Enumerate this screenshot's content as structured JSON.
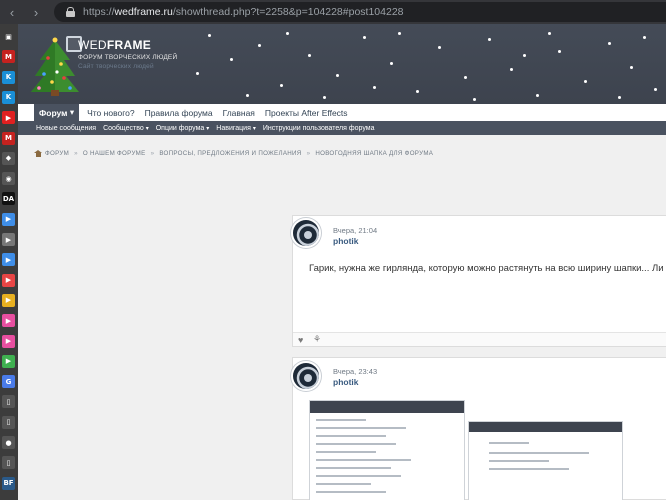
{
  "browser": {
    "url_prefix": "https://",
    "url_host": "wedframe.ru",
    "url_path": "/showthread.php?t=2258&p=104228#post104228"
  },
  "sidebar": {
    "icons": [
      {
        "name": "tab-strip-icon",
        "glyph": "▣",
        "color": "#3c3c3c"
      },
      {
        "name": "gmail-icon",
        "glyph": "M",
        "color": "#c5221f"
      },
      {
        "name": "kinopoisk-icon",
        "glyph": "K",
        "color": "#1a8fd6"
      },
      {
        "name": "kinopoisk-alt-icon",
        "glyph": "K",
        "color": "#1a8fd6"
      },
      {
        "name": "youtube-icon",
        "glyph": "▶",
        "color": "#e02020"
      },
      {
        "name": "gmail-alt-icon",
        "glyph": "M",
        "color": "#c5221f"
      },
      {
        "name": "game-icon",
        "glyph": "◆",
        "color": "#555555"
      },
      {
        "name": "speaker-icon",
        "glyph": "◉",
        "color": "#555555"
      },
      {
        "name": "deviantart-icon",
        "glyph": "DA",
        "color": "#111111"
      },
      {
        "name": "player-blue-icon",
        "glyph": "▶",
        "color": "#3f8ee8"
      },
      {
        "name": "player-grey-icon",
        "glyph": "▶",
        "color": "#777777"
      },
      {
        "name": "player-blue2-icon",
        "glyph": "▶",
        "color": "#3f8ee8"
      },
      {
        "name": "player-red-icon",
        "glyph": "▶",
        "color": "#e84545"
      },
      {
        "name": "player-yellow-icon",
        "glyph": "▶",
        "color": "#e8b020"
      },
      {
        "name": "player-pink-icon",
        "glyph": "▶",
        "color": "#e84fa0"
      },
      {
        "name": "player-pink2-icon",
        "glyph": "▶",
        "color": "#e84fa0"
      },
      {
        "name": "player-green-icon",
        "glyph": "▶",
        "color": "#3fb050"
      },
      {
        "name": "translate-icon",
        "glyph": "G",
        "color": "#4a7be8"
      },
      {
        "name": "document-icon",
        "glyph": "▯",
        "color": "#555555"
      },
      {
        "name": "document2-icon",
        "glyph": "▯",
        "color": "#555555"
      },
      {
        "name": "github-icon",
        "glyph": "●",
        "color": "#555555"
      },
      {
        "name": "document3-icon",
        "glyph": "▯",
        "color": "#555555"
      },
      {
        "name": "binance-icon",
        "glyph": "BF",
        "color": "#2a5a8a"
      }
    ]
  },
  "banner": {
    "logo_title_a": "WED",
    "logo_title_b": "FRAME",
    "logo_subtitle": "ФОРУМ ТВОРЧЕСКИХ ЛЮДЕЙ",
    "logo_subtitle2": "Сайт творческих людей"
  },
  "topnav": {
    "items": [
      {
        "label": "Форум",
        "active": true
      },
      {
        "label": "Что нового?",
        "active": false
      },
      {
        "label": "Правила форума",
        "active": false
      },
      {
        "label": "Главная",
        "active": false
      },
      {
        "label": "Проекты After Effects",
        "active": false
      }
    ],
    "active_caret": "▾"
  },
  "subnav": {
    "items": [
      {
        "label": "Новые сообщения",
        "caret": ""
      },
      {
        "label": "Сообщество",
        "caret": "▾"
      },
      {
        "label": "Опции форума",
        "caret": "▾"
      },
      {
        "label": "Навигация",
        "caret": "▾"
      },
      {
        "label": "Инструкции пользователя форума",
        "caret": ""
      }
    ]
  },
  "breadcrumb": {
    "items": [
      "ФОРУМ",
      "О НАШЕМ ФОРУМЕ",
      "ВОПРОСЫ, ПРЕДЛОЖЕНИЯ И ПОЖЕЛАНИЯ",
      "НОВОГОДНЯЯ ШАПКА ДЛЯ ФОРУМА"
    ],
    "separator": "»"
  },
  "posts": [
    {
      "date": "Вчера, 21:04",
      "user": "photik",
      "text": "Гарик, нужна же гирлянда, которую можно растянуть на всю ширину шапки... Ли"
    },
    {
      "date": "Вчера, 23:43",
      "user": "photik",
      "text": ""
    }
  ],
  "actions": {
    "like_glyph": "♥",
    "thanks_glyph": "⚘"
  },
  "colors": {
    "banner": "#3f4550",
    "nav_active": "#4a5260",
    "username": "#3a5b80"
  }
}
